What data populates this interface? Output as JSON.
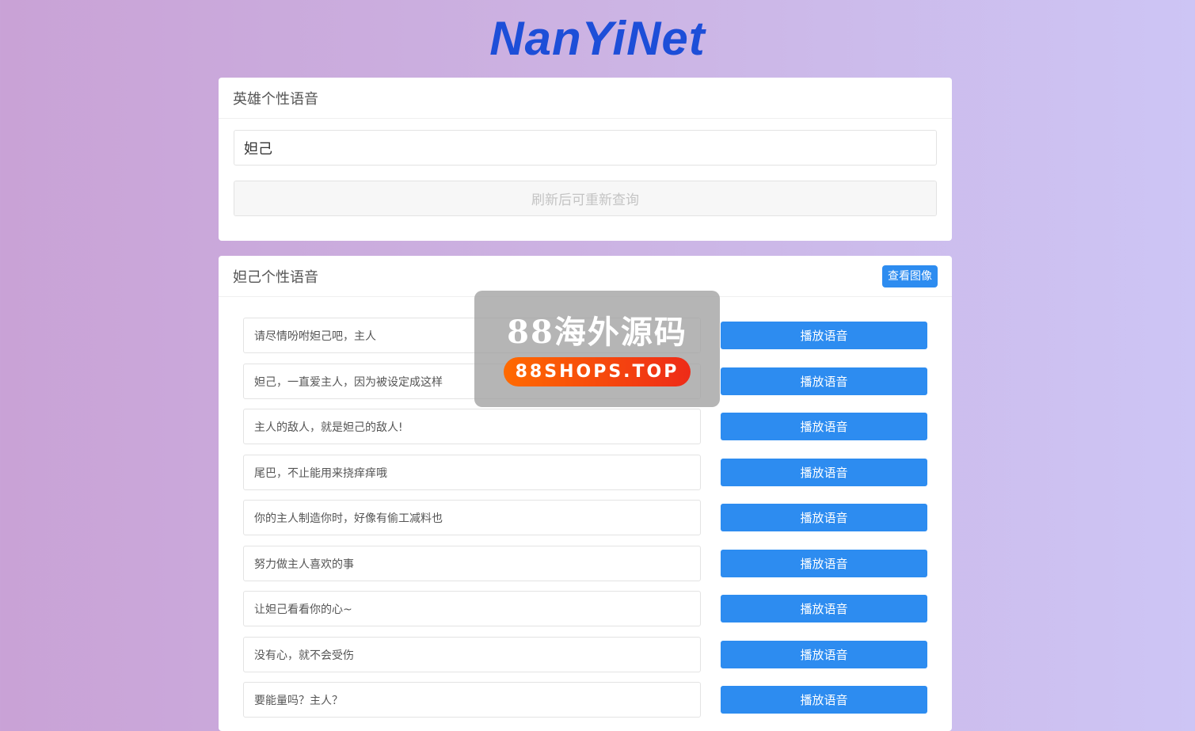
{
  "logo": {
    "text": "NanYiNet",
    "color": "#1d4ed8"
  },
  "search_card": {
    "title": "英雄个性语音",
    "input_value": "妲己",
    "refresh_label": "刷新后可重新查询"
  },
  "result_card": {
    "title": "妲己个性语音",
    "view_image_label": "查看图像",
    "accent": "#2d8cf0",
    "play_label": "播放语音",
    "voices": [
      "请尽情吩咐妲己吧，主人",
      "妲己，一直爱主人，因为被设定成这样",
      "主人的敌人，就是妲己的敌人!",
      "尾巴，不止能用来挠痒痒哦",
      "你的主人制造你时，好像有偷工减料也",
      "努力做主人喜欢的事",
      "让妲己看看你的心~",
      "没有心，就不会受伤",
      "要能量吗？主人？"
    ]
  },
  "watermark": {
    "title": "88海外源码",
    "url": "88SHOPS.TOP"
  }
}
